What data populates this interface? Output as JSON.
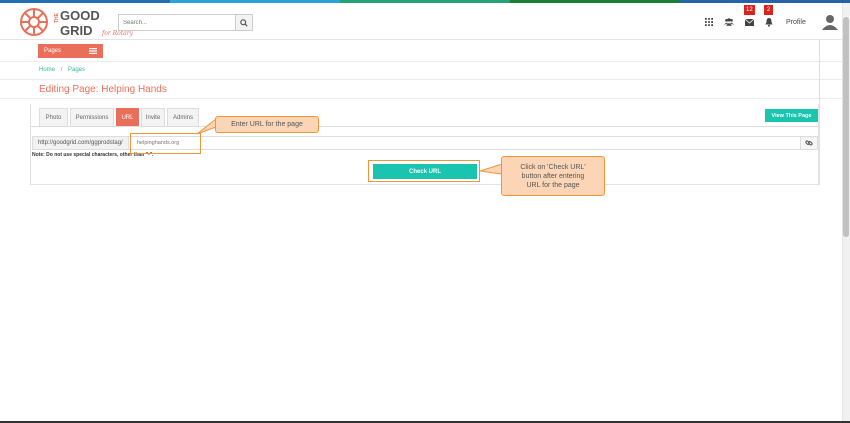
{
  "colors": {
    "accent": "#ea6f5a",
    "teal": "#1bc4ae",
    "badge": "#d9231d",
    "stripe": [
      "#1f6fb5",
      "#2aa3d8",
      "#25a27a",
      "#1b7f3a",
      "#2563a9"
    ]
  },
  "logo": {
    "the": "THE",
    "good": "GOOD",
    "grid": "GRID",
    "tagline": "for Rotary"
  },
  "search": {
    "placeholder": "Search...",
    "icon": "search-icon"
  },
  "header": {
    "icons": [
      "grid-icon",
      "users-icon",
      "mail-icon",
      "bell-icon"
    ],
    "mail_badge": "12",
    "bell_badge": "2",
    "profile_label": "Profile"
  },
  "nav": {
    "pages_label": "Pages",
    "menu_icon": "hamburger-icon"
  },
  "breadcrumb": {
    "home": "Home",
    "separator": "/",
    "pages": "Pages"
  },
  "page_title": "Editing Page: Helping Hands",
  "tabs": [
    {
      "label": "Photo"
    },
    {
      "label": "Permissions"
    },
    {
      "label": "URL",
      "active": true
    },
    {
      "label": "Invite"
    },
    {
      "label": "Admins"
    }
  ],
  "view_page_label": "View This Page",
  "url": {
    "prefix": "http://goodgrid.com/ggprodstag/",
    "value": "helpinghands.org",
    "link_icon": "link-icon"
  },
  "note": "Note: Do not use special characters, other than \"-\".",
  "check_url_label": "Check URL",
  "callouts": {
    "enter_url": "Enter URL for the page",
    "check_url": "Click on 'Check URL' button after entering URL for the page"
  }
}
